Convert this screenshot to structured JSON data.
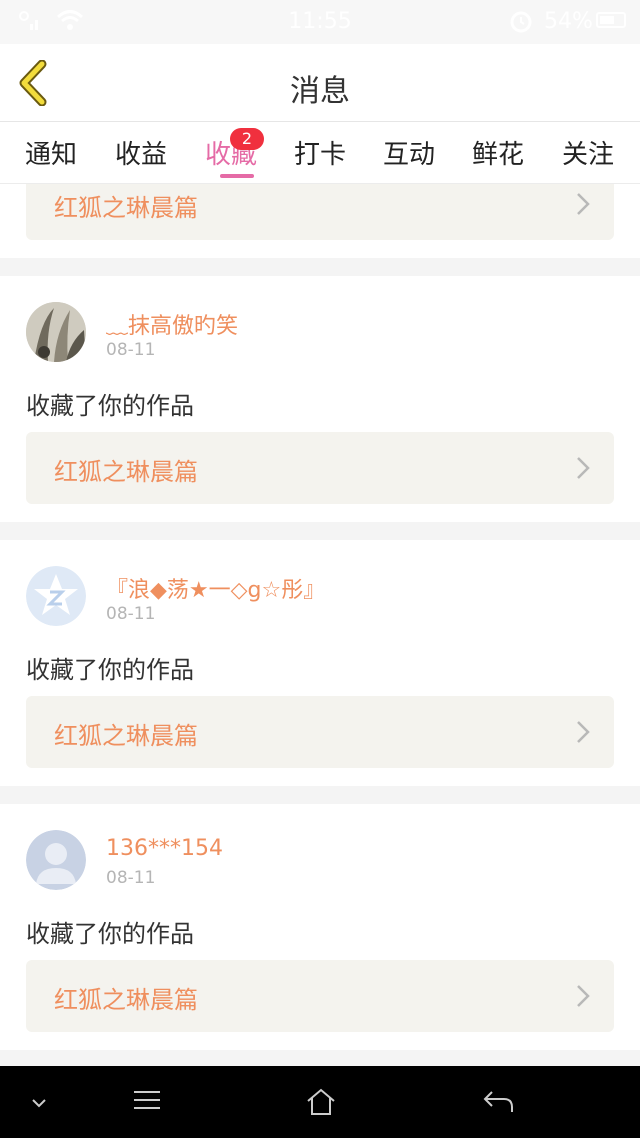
{
  "status_bar": {
    "time": "11:55",
    "battery": "54%"
  },
  "header": {
    "title": "消息"
  },
  "tabs": [
    {
      "label": "通知"
    },
    {
      "label": "收益"
    },
    {
      "label": "收藏",
      "badge": "2",
      "active": true
    },
    {
      "label": "打卡"
    },
    {
      "label": "互动"
    },
    {
      "label": "鲜花"
    },
    {
      "label": "关注"
    }
  ],
  "feed": {
    "partial_item": {
      "work_title": "红狐之琳晨篇"
    },
    "items": [
      {
        "username": "﹏抹高傲旳笑",
        "date": "08-11",
        "action": "收藏了你的作品",
        "work_title": "红狐之琳晨篇",
        "avatar": "photo-avatar"
      },
      {
        "username": "『浪◆荡★一◇g☆彤』",
        "date": "08-11",
        "action": "收藏了你的作品",
        "work_title": "红狐之琳晨篇",
        "avatar": "qq-star-avatar"
      },
      {
        "username": "136***154",
        "date": "08-11",
        "action": "收藏了你的作品",
        "work_title": "红狐之琳晨篇",
        "avatar": "default-user-avatar"
      }
    ]
  },
  "colors": {
    "accent_pink": "#e56ba6",
    "orange_text": "#ef8f5e",
    "badge_red": "#f0303e"
  }
}
